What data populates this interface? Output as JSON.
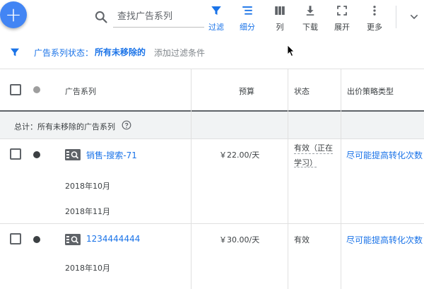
{
  "toolbar": {
    "add_icon": "plus-icon",
    "search": {
      "placeholder": "查找广告系列",
      "value": ""
    },
    "buttons": [
      {
        "id": "filter",
        "label": "过滤",
        "icon": "filter-icon",
        "active": true
      },
      {
        "id": "segment",
        "label": "细分",
        "icon": "segment-icon",
        "active": true
      },
      {
        "id": "columns",
        "label": "列",
        "icon": "columns-icon",
        "active": false
      },
      {
        "id": "download",
        "label": "下载",
        "icon": "download-icon",
        "active": false
      },
      {
        "id": "expand",
        "label": "展开",
        "icon": "fullscreen-icon",
        "active": false
      },
      {
        "id": "more",
        "label": "更多",
        "icon": "more-vert-icon",
        "active": false
      }
    ],
    "collapse_icon": "chevron-down-icon"
  },
  "filter_bar": {
    "status_label": "广告系列状态：",
    "status_value": "所有未移除的",
    "add_filter": "添加过滤条件"
  },
  "table": {
    "headers": {
      "campaign": "广告系列",
      "budget": "预算",
      "status": "状态",
      "bid_strategy": "出价策略类型"
    },
    "total_label": "总计：所有未移除的广告系列",
    "rows": [
      {
        "name": "销售-搜索-71",
        "budget": "￥22.00/天",
        "status_line1": "有效（正在",
        "status_line2": "学习）",
        "bid_strategy": "尽可能提高转化次数",
        "sub_rows": [
          "2018年10月",
          "2018年11月"
        ]
      },
      {
        "name": "1234444444",
        "budget": "￥30.00/天",
        "status_line1": "有效",
        "bid_strategy": "尽可能提高转化次数",
        "sub_rows": [
          "2018年10月"
        ]
      }
    ]
  },
  "colors": {
    "accent": "#1a73e8",
    "fab": "#4285f4",
    "status_dot": "#3c4043",
    "header_dot": "#9e9e9e"
  }
}
